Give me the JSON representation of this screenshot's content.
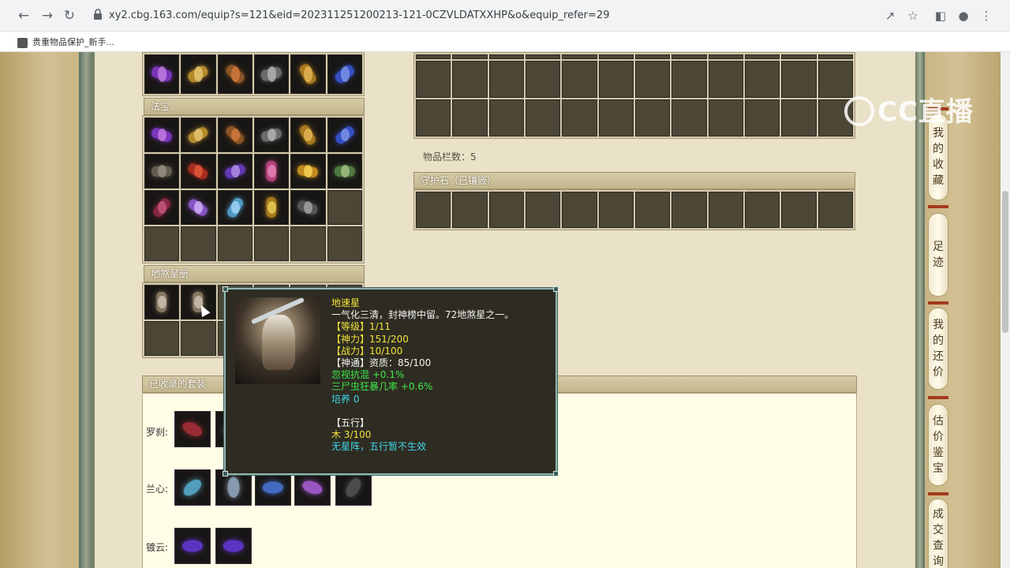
{
  "browser": {
    "url": "xy2.cbg.163.com/equip?s=121&eid=202311251200213-121-0CZVLDATXXHP&o&equip_refer=29",
    "bookmark_label": "贵重物品保护_新手..."
  },
  "sections": {
    "fabao_title": "法宝",
    "disha_title": "地煞星册",
    "guard_title": "守护石（已镶嵌）",
    "suits_title": "已收录的套装",
    "item_count_text": "物品栏数：5"
  },
  "suits": [
    {
      "label": "罗刹:",
      "icon_count": 2
    },
    {
      "label": "兰心:",
      "icon_count": 5
    },
    {
      "label": "镀云:",
      "icon_count": 2
    }
  ],
  "tooltip": {
    "name": "地速星",
    "description": "一气化三清，封神榜中留。72地煞星之一。",
    "level_key": "【等级】",
    "level_val": "1/11",
    "shenli_key": "【神力】",
    "shenli_val": "151/200",
    "zhanli_key": "【战力】",
    "zhanli_val": "10/100",
    "shentong_key": "【神通】",
    "shentong_val": "资质：85/100",
    "attr1": "忽视抗混 +0.1%",
    "attr2": "三尸虫狂暴几率 +0.6%",
    "cultivate": "培养 0",
    "wuxing_title": "【五行】",
    "wuxing_val": "木 3/100",
    "wuxing_note": "无星阵，五行暂不生效"
  },
  "side_tabs": [
    {
      "label": [
        "我",
        "的",
        "收",
        "藏"
      ]
    },
    {
      "label": [
        "足",
        "迹"
      ]
    },
    {
      "label": [
        "我",
        "的",
        "还",
        "价"
      ]
    },
    {
      "label": [
        "估",
        "价",
        "鉴",
        "宝"
      ]
    },
    {
      "label": [
        "成",
        "交",
        "查",
        "询"
      ]
    }
  ],
  "watermark": "CC直播",
  "colors": {
    "panel_bg": "#e9e1c8",
    "slot_empty": "#4b4636",
    "tooltip_bg": "#2e2c22",
    "tooltip_border": "#8fb5b0",
    "text_yellow": "#f2e23a",
    "text_green": "#3ee84a",
    "text_cyan": "#3fd6e8"
  },
  "icons": {
    "fabao_items": [
      "purple-claw-icon",
      "gold-hook-icon",
      "pipa-icon",
      "black-whip-icon",
      "gold-staff-icon",
      "blue-gauntlet-icon",
      "stone-tablet-icon",
      "red-rope-icon",
      "crystal-fan-icon",
      "pink-lantern-icon",
      "fire-orb-icon",
      "green-jade-icon",
      "red-fan-icon",
      "purple-bell-icon",
      "ice-sword-icon",
      "gold-pagoda-icon",
      "dark-whip-icon"
    ],
    "top_items": [
      "purple-gem-icon",
      "boots-icon",
      "green-gourd-icon",
      "jade-bracelet-icon",
      "green-orb-icon"
    ]
  }
}
